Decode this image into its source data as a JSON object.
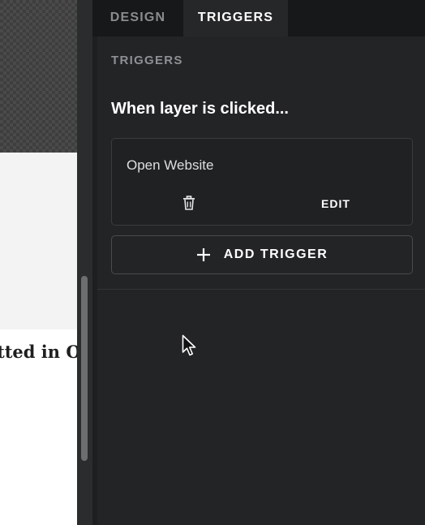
{
  "canvas": {
    "text_snippet": "tted in O"
  },
  "tabs": [
    {
      "label": "DESIGN",
      "active": false
    },
    {
      "label": "TRIGGERS",
      "active": true
    }
  ],
  "triggers": {
    "section_label": "TRIGGERS",
    "heading": "When layer is clicked...",
    "items": [
      {
        "action": "Open Website",
        "delete_icon": "trash-icon",
        "edit_label": "EDIT"
      }
    ],
    "add_button": {
      "icon": "plus-icon",
      "label": "ADD TRIGGER"
    }
  },
  "colors": {
    "panel_bg": "#232426",
    "tab_bar_bg": "#171819",
    "active_tab_bg": "#262729",
    "text_primary": "#ffffff",
    "text_muted": "#8e9093",
    "card_border": "#3b3c3f"
  }
}
